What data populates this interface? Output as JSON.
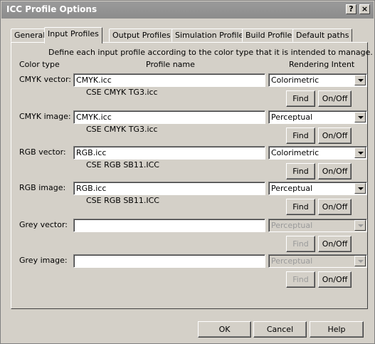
{
  "window": {
    "title": "ICC Profile Options",
    "help_btn": "?",
    "close_btn": "×"
  },
  "tabs": [
    "General",
    "Input Profiles",
    "Output Profiles",
    "Simulation Profile",
    "Build Profile",
    "Default paths"
  ],
  "active_tab": "Input Profiles",
  "panel": {
    "description": "Define each input profile according to the color type that it is intended to manage.",
    "col_color_type": "Color type",
    "col_profile_name": "Profile name",
    "col_rendering_intent": "Rendering Intent"
  },
  "rows": [
    {
      "label": "CMYK vector:",
      "profile": "CMYK.icc",
      "resolved": "CSE CMYK TG3.icc",
      "intent": "Colorimetric",
      "find": "Find",
      "onoff": "On/Off",
      "enabled": true
    },
    {
      "label": "CMYK image:",
      "profile": "CMYK.icc",
      "resolved": "CSE CMYK TG3.icc",
      "intent": "Perceptual",
      "find": "Find",
      "onoff": "On/Off",
      "enabled": true
    },
    {
      "label": "RGB vector:",
      "profile": "RGB.icc",
      "resolved": "CSE RGB SB11.ICC",
      "intent": "Colorimetric",
      "find": "Find",
      "onoff": "On/Off",
      "enabled": true
    },
    {
      "label": "RGB image:",
      "profile": "RGB.icc",
      "resolved": "CSE RGB SB11.ICC",
      "intent": "Perceptual",
      "find": "Find",
      "onoff": "On/Off",
      "enabled": true
    },
    {
      "label": "Grey vector:",
      "profile": "",
      "resolved": "",
      "intent": "Perceptual",
      "find": "Find",
      "onoff": "On/Off",
      "enabled": false
    },
    {
      "label": "Grey image:",
      "profile": "",
      "resolved": "",
      "intent": "Perceptual",
      "find": "Find",
      "onoff": "On/Off",
      "enabled": false
    }
  ],
  "footer": {
    "ok": "OK",
    "cancel": "Cancel",
    "help": "Help"
  }
}
